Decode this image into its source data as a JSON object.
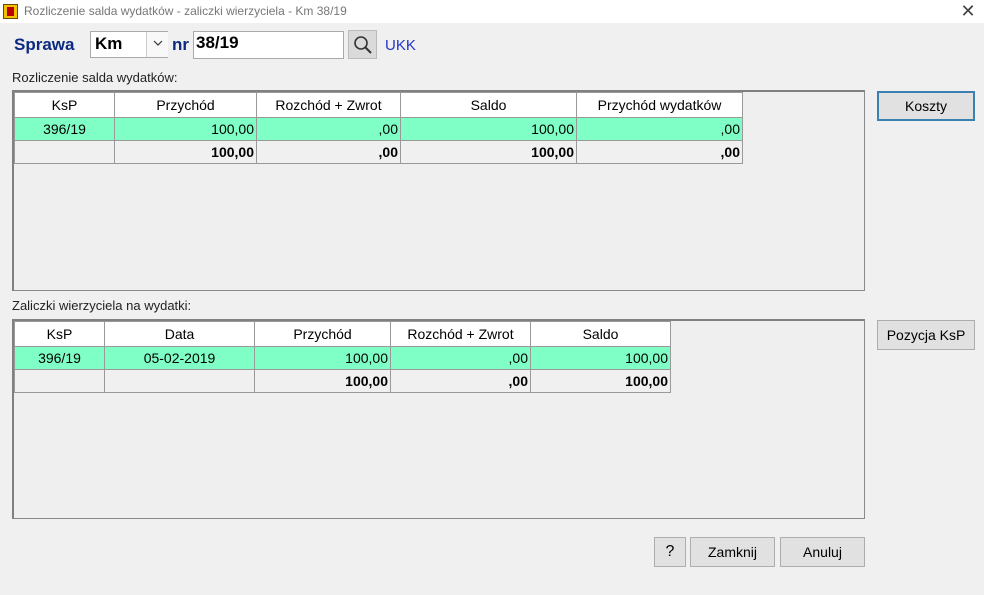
{
  "window": {
    "title": "Rozliczenie salda wydatków - zaliczki wierzyciela - Km 38/19"
  },
  "header": {
    "sprawa_label": "Sprawa",
    "type_value": "Km",
    "nr_label": "nr",
    "nr_value": "38/19",
    "court_link": "UKK"
  },
  "section1": {
    "label": "Rozliczenie salda wydatków:",
    "columns": [
      "KsP",
      "Przychód",
      "Rozchód + Zwrot",
      "Saldo",
      "Przychód wydatków"
    ],
    "rows": [
      {
        "ksp": "396/19",
        "przychod": "100,00",
        "rozchod": ",00",
        "saldo": "100,00",
        "przychod_wyd": ",00"
      }
    ],
    "totals": {
      "ksp": "",
      "przychod": "100,00",
      "rozchod": ",00",
      "saldo": "100,00",
      "przychod_wyd": ",00"
    }
  },
  "section2": {
    "label": "Zaliczki wierzyciela na wydatki:",
    "columns": [
      "KsP",
      "Data",
      "Przychód",
      "Rozchód + Zwrot",
      "Saldo"
    ],
    "rows": [
      {
        "ksp": "396/19",
        "data": "05-02-2019",
        "przychod": "100,00",
        "rozchod": ",00",
        "saldo": "100,00"
      }
    ],
    "totals": {
      "ksp": "",
      "data": "",
      "przychod": "100,00",
      "rozchod": ",00",
      "saldo": "100,00"
    }
  },
  "buttons": {
    "koszty": "Koszty",
    "pozycja": "Pozycja KsP",
    "help": "?",
    "zamknij": "Zamknij",
    "anuluj": "Anuluj"
  },
  "colors": {
    "highlight_row": "#7fffc6",
    "label_blue": "#0b2a80",
    "link_blue": "#2233cc"
  },
  "icons": {
    "search": "search-icon",
    "dropdown": "chevron-down-icon",
    "close": "close-icon"
  }
}
